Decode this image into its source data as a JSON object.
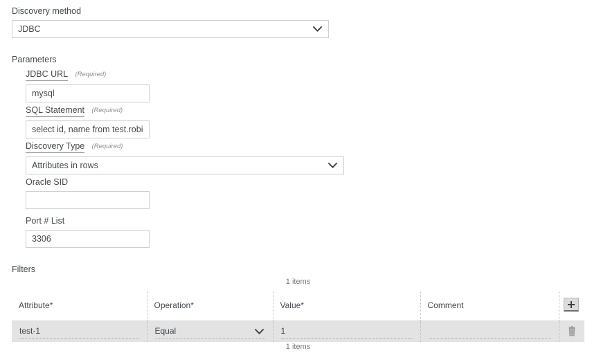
{
  "form": {
    "discovery_method": {
      "label": "Discovery method",
      "value": "JDBC",
      "icon": "chevron-down-icon"
    },
    "parameters_label": "Parameters",
    "required_note": "(Required)",
    "fields": [
      {
        "key": "jdbc_url",
        "label": "JDBC URL",
        "required": true,
        "underlined": true,
        "type": "text",
        "value": "mysql",
        "placeholder": ""
      },
      {
        "key": "sql_statement",
        "label": "SQL Statement",
        "required": true,
        "underlined": true,
        "type": "text",
        "value": "select id, name from test.robin_test",
        "placeholder": ""
      },
      {
        "key": "discovery_type",
        "label": "Discovery Type",
        "required": true,
        "underlined": true,
        "type": "select",
        "value": "Attributes in rows",
        "placeholder": ""
      },
      {
        "key": "oracle_sid",
        "label": "Oracle SID",
        "required": false,
        "underlined": false,
        "type": "text",
        "value": "",
        "placeholder": ""
      },
      {
        "key": "port_list",
        "label": "Port # List",
        "required": false,
        "underlined": false,
        "type": "text",
        "value": "3306",
        "placeholder": ""
      }
    ]
  },
  "filters": {
    "label": "Filters",
    "items_count_top": "1 items",
    "items_count_bottom": "1 items",
    "add_button": {
      "icon": "plus-icon",
      "label": ""
    },
    "columns": [
      {
        "key": "attribute",
        "header": "Attribute*"
      },
      {
        "key": "operation",
        "header": "Operation*"
      },
      {
        "key": "value",
        "header": "Value*"
      },
      {
        "key": "comment",
        "header": "Comment"
      }
    ],
    "rows": [
      {
        "attribute": "test-1",
        "operation": "Equal",
        "value": "1",
        "comment": "",
        "delete_icon": "trash-icon"
      }
    ]
  },
  "colors": {
    "row_background": "#e3e3e3",
    "border": "#cfcfcf",
    "text": "#45484c",
    "muted_text": "#8b8e92",
    "dotted": "#a6a6a6"
  }
}
